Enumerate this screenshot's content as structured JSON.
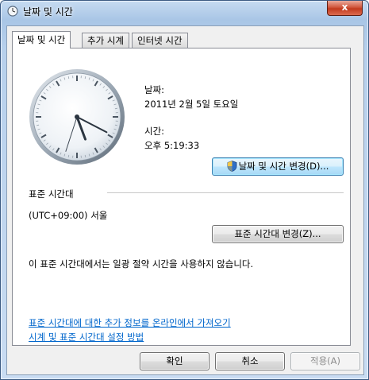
{
  "window": {
    "title": "날짜 및 시간",
    "close_glyph": "x"
  },
  "tabs": [
    {
      "label": "날짜 및 시간",
      "active": true
    },
    {
      "label": "추가 시계",
      "active": false
    },
    {
      "label": "인터넷 시간",
      "active": false
    }
  ],
  "datetime": {
    "date_label": "날짜:",
    "date_value": "2011년 2월 5일 토요일",
    "time_label": "시간:",
    "time_value": "오후 5:19:33",
    "change_button": "날짜 및 시간 변경(D)...",
    "clock": {
      "hour": 5,
      "minute": 19,
      "second": 33
    }
  },
  "timezone": {
    "section_label": "표준 시간대",
    "value": "(UTC+09:00) 서울",
    "change_button": "표준 시간대 변경(Z)...",
    "dst_note": "이 표준 시간대에서는 일광 절약 시간을 사용하지 않습니다."
  },
  "links": {
    "online_info": "표준 시간대에 대한 추가 정보를 온라인에서 가져오기",
    "help": "시계 및 표준 시간대 설정 방법"
  },
  "footer": {
    "ok": "확인",
    "cancel": "취소",
    "apply": "적용(A)"
  },
  "icons": {
    "app": "clock-icon",
    "uac": "uac-shield-icon"
  }
}
